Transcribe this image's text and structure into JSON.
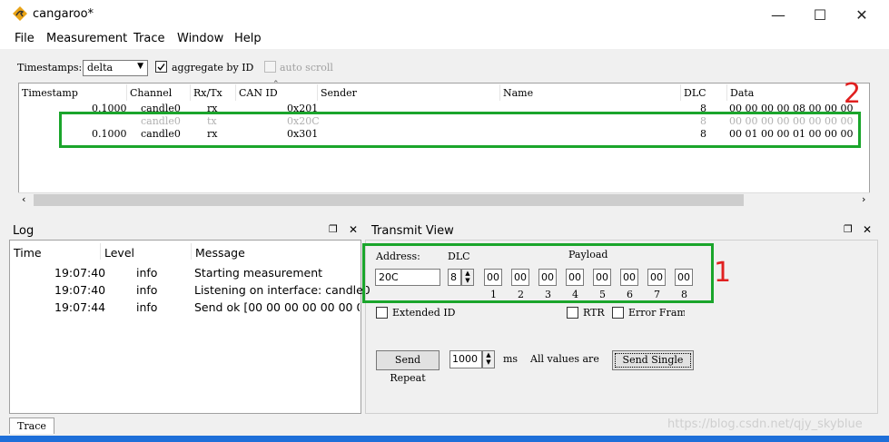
{
  "window": {
    "title": "cangaroo*",
    "min": "—",
    "max": "☐",
    "close": "✕"
  },
  "menu": [
    "File",
    "Measurement",
    "Trace",
    "Window",
    "Help"
  ],
  "toolbar": {
    "timestamps_label": "Timestamps:",
    "timestamps_value": "delta",
    "aggregate_label": "aggregate by ID",
    "autoscroll_label": "auto scroll"
  },
  "trace": {
    "columns": [
      "Timestamp",
      "Channel",
      "Rx/Tx",
      "CAN ID",
      "Sender",
      "Name",
      "DLC",
      "Data"
    ],
    "rows": [
      {
        "timestamp": "0.1000",
        "channel": "candle0",
        "rxtx": "rx",
        "canid": "0x201",
        "dlc": "8",
        "data": "00 00 00 00 08 00 00 00",
        "dim": false
      },
      {
        "timestamp": "",
        "channel": "candle0",
        "rxtx": "tx",
        "canid": "0x20C",
        "dlc": "8",
        "data": "00 00 00 00 00 00 00 00",
        "dim": true
      },
      {
        "timestamp": "0.1000",
        "channel": "candle0",
        "rxtx": "rx",
        "canid": "0x301",
        "dlc": "8",
        "data": "00 01 00 00 01 00 00 00",
        "dim": false
      }
    ],
    "annotation": "2"
  },
  "log": {
    "title": "Log",
    "columns": [
      "Time",
      "Level",
      "Message"
    ],
    "rows": [
      {
        "time": "19:07:40",
        "level": "info",
        "message": "Starting measurement"
      },
      {
        "time": "19:07:40",
        "level": "info",
        "message": "Listening on interface: candle0"
      },
      {
        "time": "19:07:44",
        "level": "info",
        "message": "Send ok [00 00 00 00 00 00 0..."
      }
    ]
  },
  "transmit": {
    "title": "Transmit View",
    "address_label": "Address:",
    "dlc_label": "DLC",
    "payload_label": "Payload",
    "address_value": "20C",
    "dlc_value": "8",
    "bytes": [
      "00",
      "00",
      "00",
      "00",
      "00",
      "00",
      "00",
      "00"
    ],
    "byte_indices": [
      "1",
      "2",
      "3",
      "4",
      "5",
      "6",
      "7",
      "8"
    ],
    "extended_id": "Extended ID",
    "rtr": "RTR",
    "error_frame": "Error Fram",
    "send_repeat": "Send Repeat",
    "interval": "1000",
    "ms": "ms",
    "all_values": "All values are",
    "send_single": "Send Single",
    "annotation": "1"
  },
  "bottom_tab": "Trace",
  "watermark": "https://blog.csdn.net/qjy_skyblue"
}
